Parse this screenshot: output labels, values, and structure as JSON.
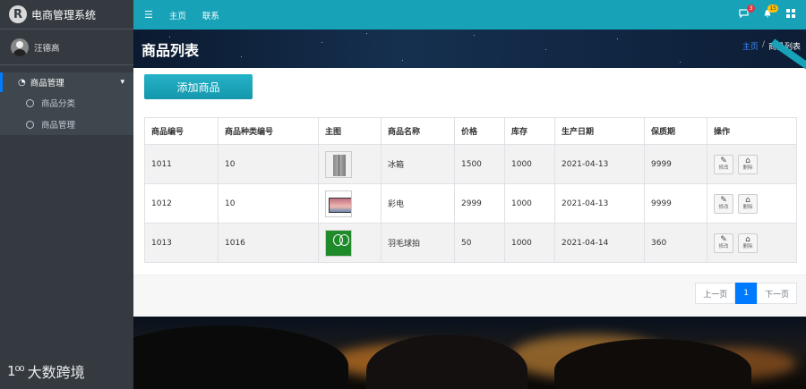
{
  "app": {
    "brand": "电商管理系统",
    "logo_char": "R"
  },
  "user": {
    "name": "汪德高"
  },
  "sidebar": {
    "group": {
      "label": "商品管理",
      "icon": "dashboard-icon"
    },
    "items": [
      {
        "label": "商品分类"
      },
      {
        "label": "商品管理"
      }
    ]
  },
  "topbar": {
    "menu_icon": "☰",
    "links": [
      "主页",
      "联系"
    ],
    "messages_count": "3",
    "notifications_count": "15"
  },
  "header": {
    "title": "商品列表",
    "breadcrumb": {
      "home": "主页",
      "sep": "/",
      "current": "商品列表"
    }
  },
  "toolbar": {
    "add_label": "添加商品"
  },
  "table": {
    "columns": [
      "商品编号",
      "商品种类编号",
      "主图",
      "商品名称",
      "价格",
      "库存",
      "生产日期",
      "保质期",
      "操作"
    ],
    "rows": [
      {
        "id": "1011",
        "category_id": "10",
        "image": "fridge",
        "name": "冰箱",
        "price": "1500",
        "stock": "1000",
        "date": "2021-04-13",
        "shelf_life": "9999"
      },
      {
        "id": "1012",
        "category_id": "10",
        "image": "tv",
        "name": "彩电",
        "price": "2999",
        "stock": "1000",
        "date": "2021-04-13",
        "shelf_life": "9999"
      },
      {
        "id": "1013",
        "category_id": "1016",
        "image": "racket",
        "name": "羽毛球拍",
        "price": "50",
        "stock": "1000",
        "date": "2021-04-14",
        "shelf_life": "360"
      }
    ],
    "edit_label": "修改",
    "delete_label": "删除"
  },
  "pagination": {
    "prev": "上一页",
    "current": "1",
    "next": "下一页"
  },
  "watermark": {
    "logo": "1⁰⁰",
    "text": "大数跨境"
  },
  "colors": {
    "accent": "#17a2b8",
    "sidebar": "#343a40",
    "primary": "#007bff"
  }
}
